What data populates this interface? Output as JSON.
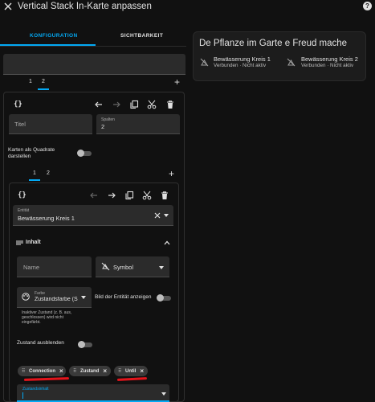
{
  "header": {
    "title": "Vertical Stack In-Karte anpassen"
  },
  "tabs": [
    {
      "label": "Konfiguration"
    },
    {
      "label": "Sichtbarkeit"
    }
  ],
  "outer": {
    "tabs": [
      "1",
      "2"
    ],
    "title_placeholder": "Titel",
    "columns_label": "Spalten",
    "columns_value": "2",
    "square_label_line1": "Karten als Quadrate",
    "square_label_line2": "darstellen",
    "inner_tabs": [
      "1",
      "2"
    ]
  },
  "inner": {
    "entity_label": "Entität",
    "entity_value": "Bewässerung Kreis 1",
    "section_title": "Inhalt",
    "name_placeholder": "Name",
    "symbol_placeholder": "Symbol",
    "color_label": "Farbe",
    "color_value": "Zustandsfarbe (S",
    "show_entity_image_label": "Bild der Entität anzeigen",
    "color_hint_line1": "Inaktiver Zustand (z. B. aus,",
    "color_hint_line2": "geschlossen) wird nicht",
    "color_hint_line3": "eingefärbt.",
    "hide_state_label": "Zustand ausblenden",
    "chips": [
      {
        "label": "Connection"
      },
      {
        "label": "Zustand"
      },
      {
        "label": "Until"
      }
    ],
    "state_content_label": "Zustandsinhalt"
  },
  "preview": {
    "title": "De Pflanze im Garte e Freud mache",
    "entities": [
      {
        "name": "Bewässerung Kreis 1",
        "state": "Verbunden · Nicht aktiv"
      },
      {
        "name": "Bewässerung Kreis 2",
        "state": "Verbunden · Nicht aktiv"
      }
    ]
  },
  "colors": {
    "accent": "#03a9f4",
    "background": "#111111",
    "field": "#2b2b2b",
    "annotation": "#e3141b"
  },
  "icons": [
    "close-icon",
    "help-icon",
    "code-icon",
    "arrow-left-icon",
    "arrow-right-icon",
    "copy-icon",
    "cut-icon",
    "delete-icon",
    "plus-icon",
    "clear-icon",
    "chevron-down-icon",
    "chevron-up-icon",
    "list-icon",
    "symbol-off-icon",
    "palette-icon",
    "drag-handle-icon",
    "close-small-icon"
  ]
}
